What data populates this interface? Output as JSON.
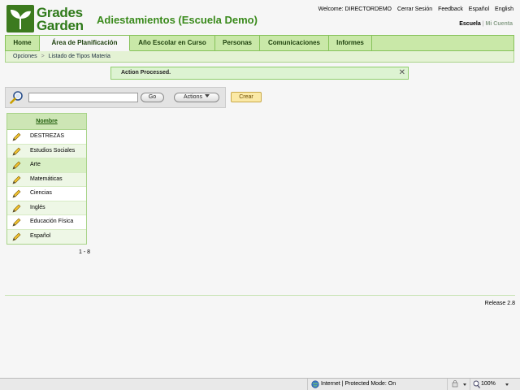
{
  "brand": {
    "line1": "Grades",
    "line2": "Garden"
  },
  "app_title": "Adiestamientos (Escuela Demo)",
  "top_links": {
    "welcome": "Welcome: DIRECTORDEMO",
    "logout": "Cerrar Sesión",
    "feedback": "Feedback",
    "spanish": "Español",
    "english": "English"
  },
  "scope": {
    "active": "Escuela",
    "separator": "|",
    "inactive": "Mi Cuenta"
  },
  "nav": {
    "tabs": [
      {
        "label": "Home"
      },
      {
        "label": "Área de Planificación"
      },
      {
        "label": "Año Escolar en Curso"
      },
      {
        "label": "Personas"
      },
      {
        "label": "Comunicaciones"
      },
      {
        "label": "Informes"
      }
    ],
    "active_tab": "Área de Planificación"
  },
  "breadcrumb": {
    "items": [
      "Opciones",
      "Listado de Tipos Materia"
    ],
    "separator": ">"
  },
  "message": {
    "text": "Action Processed.",
    "close": "✕"
  },
  "search": {
    "value": "",
    "go_label": "Go",
    "actions_label": "Actions"
  },
  "create_label": "Crear",
  "table": {
    "header": "Nombre",
    "rows": [
      "DESTREZAS",
      "Estudios Sociales",
      "Arte",
      "Matemáticas",
      "Ciencias",
      "Inglés",
      "Educación Física",
      "Español"
    ]
  },
  "pager": "1 - 8",
  "release": "Release 2.8",
  "statusbar": {
    "zone": "Internet | Protected Mode: On",
    "zoom": "100%"
  },
  "colors": {
    "brand_green": "#3c7a1e",
    "nav_bg": "#c9e8a8",
    "create_bg": "#fbe9a6"
  }
}
